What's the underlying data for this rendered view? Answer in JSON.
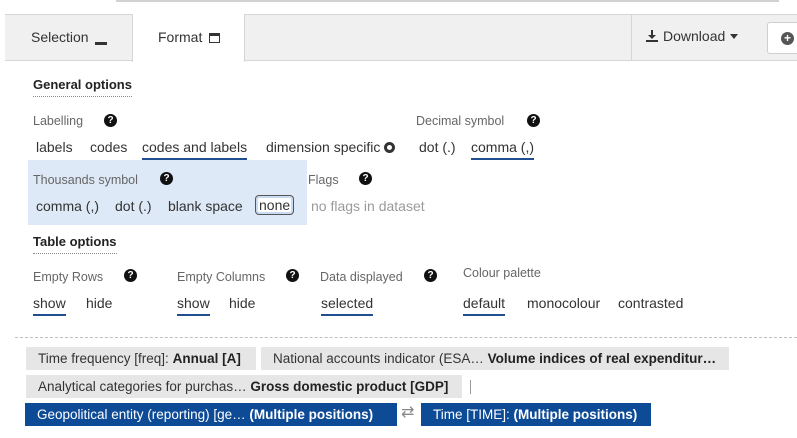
{
  "tabs": {
    "selection_label": "Selection",
    "format_label": "Format"
  },
  "toolbar": {
    "download_label": "Download"
  },
  "general_options": {
    "title": "General options",
    "labelling": {
      "label": "Labelling",
      "options": [
        "labels",
        "codes",
        "codes and labels",
        "dimension specific"
      ],
      "selected": "codes and labels"
    },
    "decimal_symbol": {
      "label": "Decimal symbol",
      "options": [
        "dot (.)",
        "comma (,)"
      ],
      "selected": "comma (,)"
    },
    "thousands_symbol": {
      "label": "Thousands symbol",
      "options": [
        "comma (,)",
        "dot (.)",
        "blank space",
        "none"
      ],
      "selected": "none"
    },
    "flags": {
      "label": "Flags",
      "value": "no flags in dataset"
    }
  },
  "table_options": {
    "title": "Table options",
    "empty_rows": {
      "label": "Empty Rows",
      "options": [
        "show",
        "hide"
      ],
      "selected": "show"
    },
    "empty_columns": {
      "label": "Empty Columns",
      "options": [
        "show",
        "hide"
      ],
      "selected": "show"
    },
    "data_displayed": {
      "label": "Data displayed",
      "value": "selected"
    },
    "colour_palette": {
      "label": "Colour palette",
      "options": [
        "default",
        "monocolour",
        "contrasted"
      ],
      "selected": "default"
    }
  },
  "dimension_chips": [
    {
      "label": "Time frequency [freq]:",
      "value": "Annual [A]"
    },
    {
      "label": "National accounts indicator (ESA…",
      "value": "Volume indices of real expenditur…"
    },
    {
      "label": "Analytical categories for purchas…",
      "value": "Gross domestic product [GDP]"
    }
  ],
  "axis_chips": [
    {
      "label": "Geopolitical entity (reporting) [ge…",
      "value": "(Multiple positions)"
    },
    {
      "label": "Time [TIME]:",
      "value": "(Multiple positions)"
    }
  ],
  "help_glyph": "?",
  "swap_glyph": "⇄",
  "colors": {
    "accent": "#1f4f8f",
    "axis_chip": "#0e4b97",
    "highlight": "#dde9f6"
  }
}
